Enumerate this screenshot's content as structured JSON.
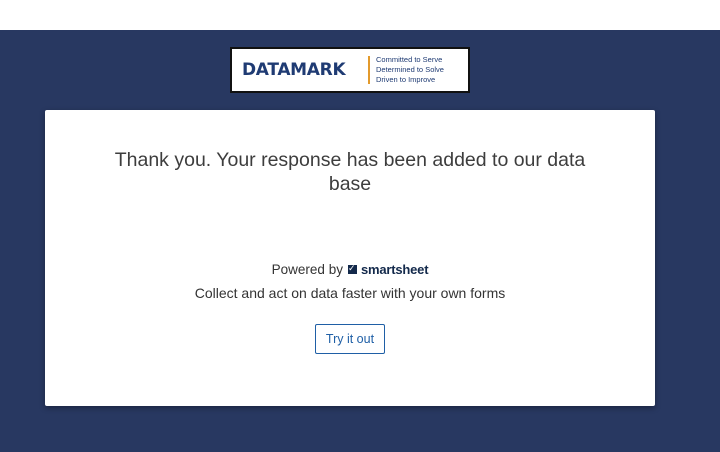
{
  "logo": {
    "wordmark": "DATAMARK",
    "taglines": [
      "Committed to Serve",
      "Determined to Solve",
      "Driven to Improve"
    ],
    "divider_color": "#e39a2c",
    "brand_color": "#1f3b73"
  },
  "confirmation": {
    "message": "Thank you. Your response has been added to our data base"
  },
  "footer": {
    "powered_by_label": "Powered by",
    "brand_icon": "smartsheet-logo-icon",
    "brand_name": "smartsheet",
    "pitch": "Collect and act on data faster with your own forms",
    "cta_label": "Try it out"
  },
  "colors": {
    "background": "#283861",
    "card": "#ffffff",
    "accent": "#1f5fa6"
  }
}
